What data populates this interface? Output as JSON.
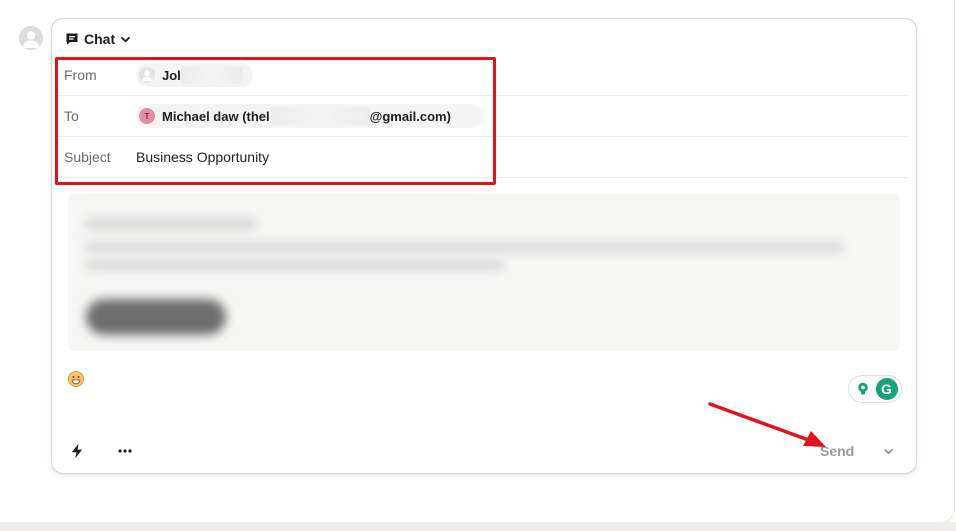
{
  "composer": {
    "mode_label": "Chat",
    "fields": {
      "from_label": "From",
      "from_value": "Jol",
      "to_label": "To",
      "to_avatar_letter": "T",
      "to_value_prefix": "Michael daw (thel",
      "to_value_suffix": "@gmail.com)",
      "subject_label": "Subject",
      "subject_value": "Business Opportunity"
    },
    "toolbar": {
      "send_label": "Send"
    },
    "grammarly_letter": "G"
  },
  "colors": {
    "annotation_red": "#e3131b",
    "grammarly_green": "#15a37a",
    "recipient_avatar": "#e98aa6",
    "send_text": "#9a9a9a"
  },
  "icons": {
    "mode": "chat-bubble-icon",
    "mode_toggle": "chevron-down-icon",
    "quick_actions": "lightning-icon",
    "more": "more-horizontal-icon",
    "send_options": "chevron-down-icon",
    "emoji": "grinning-emoji-icon",
    "grammarly_suggest": "lightbulb-icon"
  }
}
